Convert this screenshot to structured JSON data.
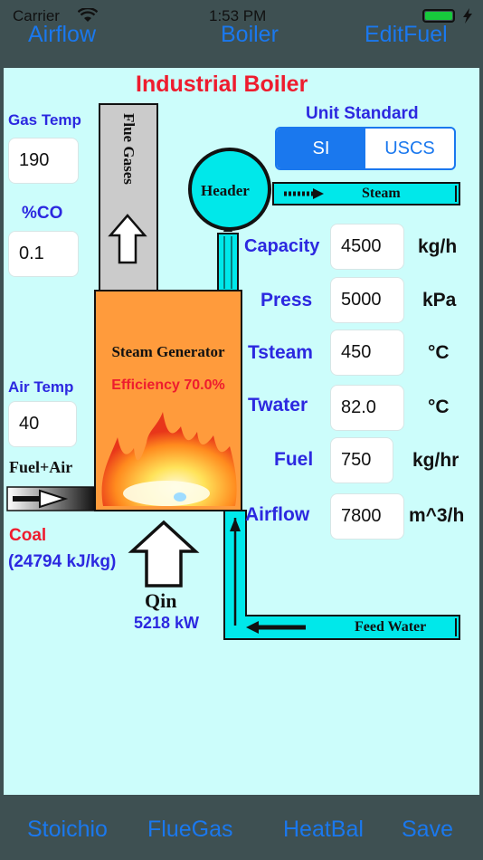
{
  "status_bar": {
    "carrier": "Carrier",
    "time": "1:53 PM"
  },
  "nav": {
    "airflow": "Airflow",
    "boiler": "Boiler",
    "edit_fuel": "EditFuel"
  },
  "title": "Industrial Boiler",
  "unit_standard": {
    "label": "Unit Standard",
    "options": [
      "SI",
      "USCS"
    ],
    "selected": "SI"
  },
  "left": {
    "gas_temp_label": "Gas Temp",
    "gas_temp_value": "190",
    "co_label": "%CO",
    "co_value": "0.1",
    "air_temp_label": "Air Temp",
    "air_temp_value": "40",
    "fuel_air_label": "Fuel+Air",
    "fuel_name": "Coal",
    "fuel_hv": "(24794 kJ/kg)"
  },
  "diagram": {
    "flue_gases": "Flue Gases",
    "header": "Header",
    "steam": "Steam",
    "steam_generator": "Steam Generator",
    "efficiency": "Efficiency 70.0%",
    "qin_label": "Qin",
    "qin_value": "5218 kW",
    "feed_water": "Feed Water"
  },
  "params": [
    {
      "label": "Capacity",
      "value": "4500",
      "unit": "kg/h"
    },
    {
      "label": "Press",
      "value": "5000",
      "unit": "kPa"
    },
    {
      "label": "Tsteam",
      "value": "450",
      "unit": "°C"
    },
    {
      "label": "Twater",
      "value": "82.0",
      "unit": "°C"
    },
    {
      "label": "Fuel",
      "value": "750",
      "unit": "kg/hr"
    },
    {
      "label": "Airflow",
      "value": "7800",
      "unit": "m^3/h"
    }
  ],
  "tabs": {
    "stoichio": "Stoichio",
    "flue_gas": "FlueGas",
    "heat_bal": "HeatBal",
    "save": "Save"
  },
  "colors": {
    "accent": "#1a78ee",
    "title_red": "#ee1c2e",
    "label_blue": "#2c28e0",
    "pipe_cyan": "#00e8ea",
    "generator_orange": "#ff9b3c",
    "background": "#ccfdfb"
  }
}
